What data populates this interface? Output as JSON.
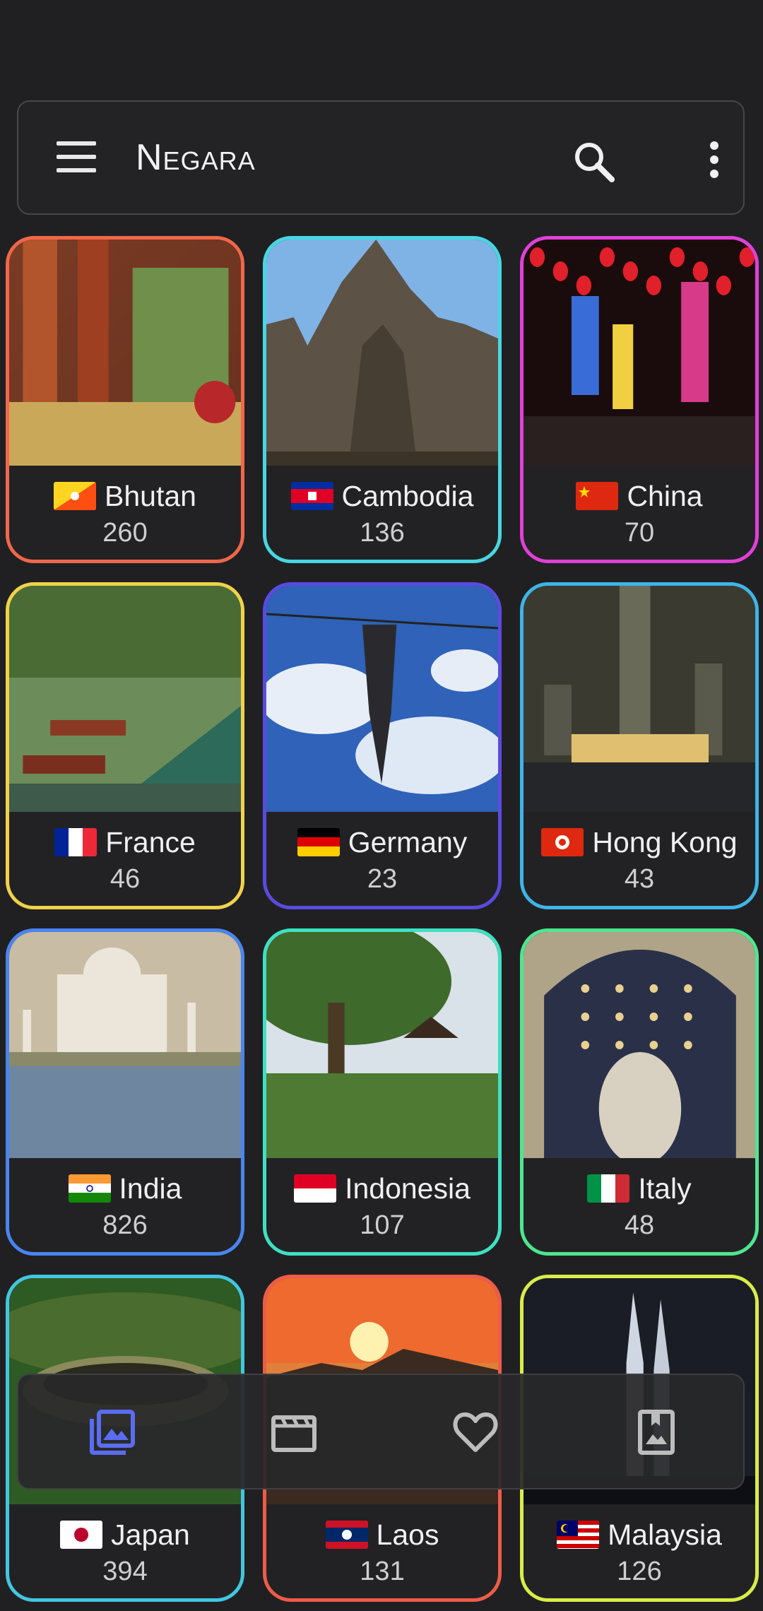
{
  "appbar": {
    "title": "Negara",
    "icons": {
      "menu": "menu-icon",
      "search": "search-icon",
      "more": "more-vert-icon"
    }
  },
  "countries": [
    {
      "name": "Bhutan",
      "count": "260",
      "border": "#f0674a"
    },
    {
      "name": "Cambodia",
      "count": "136",
      "border": "#49d6e2"
    },
    {
      "name": "China",
      "count": "70",
      "border": "#e040d8"
    },
    {
      "name": "France",
      "count": "46",
      "border": "#f1d24a"
    },
    {
      "name": "Germany",
      "count": "23",
      "border": "#5a4be0"
    },
    {
      "name": "Hong Kong",
      "count": "43",
      "border": "#3fb4e6"
    },
    {
      "name": "India",
      "count": "826",
      "border": "#4a85f0"
    },
    {
      "name": "Indonesia",
      "count": "107",
      "border": "#3fe0c2"
    },
    {
      "name": "Italy",
      "count": "48",
      "border": "#4ee690"
    },
    {
      "name": "Japan",
      "count": "394",
      "border": "#43c6e0"
    },
    {
      "name": "Laos",
      "count": "131",
      "border": "#ee5c48"
    },
    {
      "name": "Malaysia",
      "count": "126",
      "border": "#d8ec4a"
    }
  ],
  "bottom_nav": {
    "items": [
      "photo-library-icon",
      "movie-icon",
      "favorite-icon",
      "bookmark-photo-icon"
    ],
    "active_color": "#5a6cf0",
    "inactive_color": "#bdbdbd"
  }
}
